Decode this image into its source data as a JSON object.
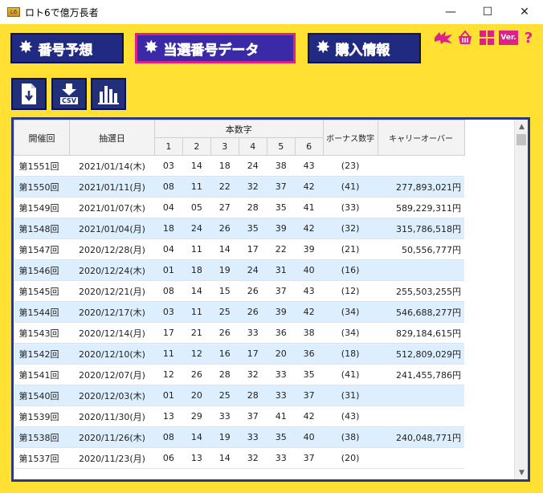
{
  "window": {
    "title": "ロト6で億万長者",
    "minimize": "—",
    "maximize": "☐",
    "close": "✕"
  },
  "nav": {
    "prediction": "番号予想",
    "winning_data": "当選番号データ",
    "purchase_info": "購入情報",
    "active": "winning_data"
  },
  "top_icons": {
    "version": "Ver.",
    "help": "?"
  },
  "tools": {
    "export_label": "",
    "csv_label": "CSV"
  },
  "table": {
    "headers": {
      "draw": "開催回",
      "date": "抽選日",
      "main_numbers": "本数字",
      "number_cols": [
        "1",
        "2",
        "3",
        "4",
        "5",
        "6"
      ],
      "bonus": "ボーナス数字",
      "carryover": "キャリーオーバー"
    },
    "rows": [
      {
        "draw": "第1551回",
        "date": "2021/01/14(木)",
        "nums": [
          "03",
          "14",
          "18",
          "24",
          "38",
          "43"
        ],
        "bonus": "(23)",
        "carry": ""
      },
      {
        "draw": "第1550回",
        "date": "2021/01/11(月)",
        "nums": [
          "08",
          "11",
          "22",
          "32",
          "37",
          "42"
        ],
        "bonus": "(41)",
        "carry": "277,893,021円"
      },
      {
        "draw": "第1549回",
        "date": "2021/01/07(木)",
        "nums": [
          "04",
          "05",
          "27",
          "28",
          "35",
          "41"
        ],
        "bonus": "(33)",
        "carry": "589,229,311円"
      },
      {
        "draw": "第1548回",
        "date": "2021/01/04(月)",
        "nums": [
          "18",
          "24",
          "26",
          "35",
          "39",
          "42"
        ],
        "bonus": "(32)",
        "carry": "315,786,518円"
      },
      {
        "draw": "第1547回",
        "date": "2020/12/28(月)",
        "nums": [
          "04",
          "11",
          "14",
          "17",
          "22",
          "39"
        ],
        "bonus": "(21)",
        "carry": "50,556,777円"
      },
      {
        "draw": "第1546回",
        "date": "2020/12/24(木)",
        "nums": [
          "01",
          "18",
          "19",
          "24",
          "31",
          "40"
        ],
        "bonus": "(16)",
        "carry": ""
      },
      {
        "draw": "第1545回",
        "date": "2020/12/21(月)",
        "nums": [
          "08",
          "14",
          "15",
          "26",
          "37",
          "43"
        ],
        "bonus": "(12)",
        "carry": "255,503,255円"
      },
      {
        "draw": "第1544回",
        "date": "2020/12/17(木)",
        "nums": [
          "03",
          "11",
          "25",
          "26",
          "39",
          "42"
        ],
        "bonus": "(34)",
        "carry": "546,688,277円"
      },
      {
        "draw": "第1543回",
        "date": "2020/12/14(月)",
        "nums": [
          "17",
          "21",
          "26",
          "33",
          "36",
          "38"
        ],
        "bonus": "(34)",
        "carry": "829,184,615円"
      },
      {
        "draw": "第1542回",
        "date": "2020/12/10(木)",
        "nums": [
          "11",
          "12",
          "16",
          "17",
          "20",
          "36"
        ],
        "bonus": "(18)",
        "carry": "512,809,029円"
      },
      {
        "draw": "第1541回",
        "date": "2020/12/07(月)",
        "nums": [
          "12",
          "26",
          "28",
          "32",
          "33",
          "35"
        ],
        "bonus": "(41)",
        "carry": "241,455,786円"
      },
      {
        "draw": "第1540回",
        "date": "2020/12/03(木)",
        "nums": [
          "01",
          "20",
          "25",
          "28",
          "33",
          "37"
        ],
        "bonus": "(31)",
        "carry": ""
      },
      {
        "draw": "第1539回",
        "date": "2020/11/30(月)",
        "nums": [
          "13",
          "29",
          "33",
          "37",
          "41",
          "42"
        ],
        "bonus": "(43)",
        "carry": ""
      },
      {
        "draw": "第1538回",
        "date": "2020/11/26(木)",
        "nums": [
          "08",
          "14",
          "19",
          "33",
          "35",
          "40"
        ],
        "bonus": "(38)",
        "carry": "240,048,771円"
      },
      {
        "draw": "第1537回",
        "date": "2020/11/23(月)",
        "nums": [
          "06",
          "13",
          "14",
          "32",
          "33",
          "37"
        ],
        "bonus": "(20)",
        "carry": ""
      }
    ]
  },
  "colors": {
    "background": "#ffe033",
    "nav_bg": "#1f2a80",
    "active_border": "#e0208a",
    "row_alt": "#ddeefe"
  }
}
